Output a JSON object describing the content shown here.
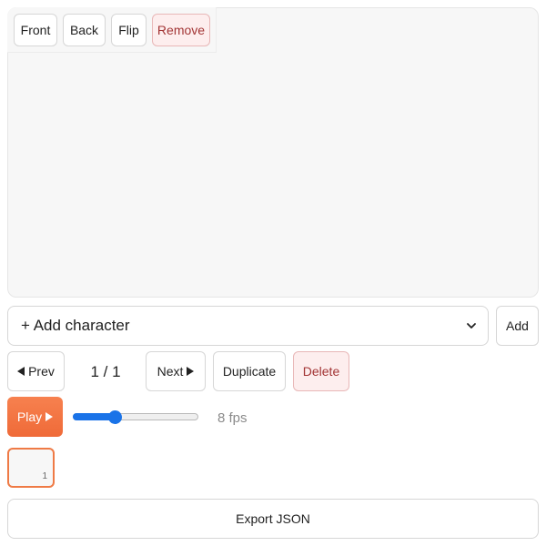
{
  "toolbar": {
    "front_label": "Front",
    "back_label": "Back",
    "flip_label": "Flip",
    "remove_label": "Remove"
  },
  "character": {
    "select_value": "+ Add character",
    "add_label": "Add"
  },
  "navigation": {
    "prev_label": "Prev",
    "counter": "1 / 1",
    "next_label": "Next",
    "duplicate_label": "Duplicate",
    "delete_label": "Delete"
  },
  "playback": {
    "play_label": "Play",
    "fps_value": 8,
    "fps_label": "8 fps",
    "slider_fraction": 0.33
  },
  "frames": [
    {
      "number": "1"
    }
  ],
  "export": {
    "label": "Export JSON"
  },
  "colors": {
    "accent": "#ef6a38",
    "slider": "#1a73e8",
    "danger_bg": "#fdeeee",
    "danger_text": "#a23434"
  }
}
